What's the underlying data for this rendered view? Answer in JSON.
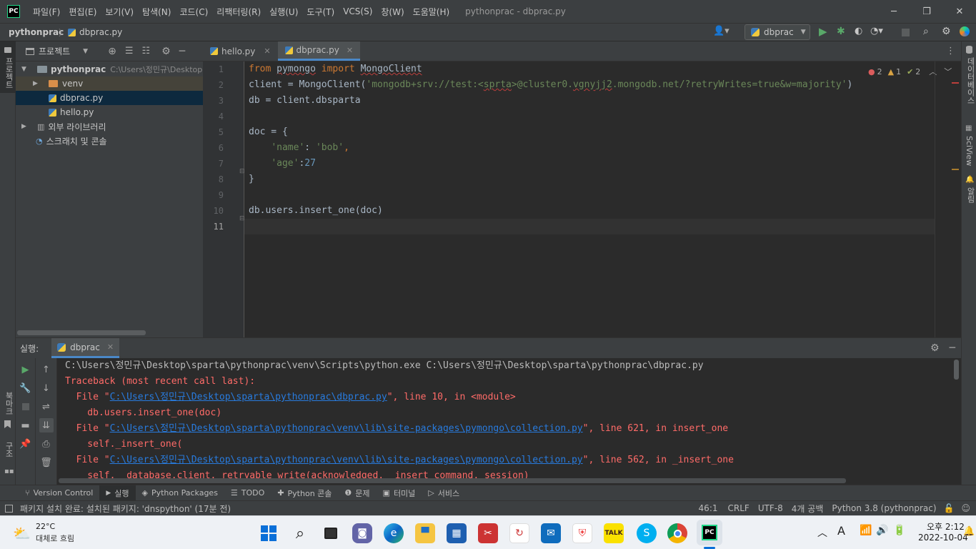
{
  "menubar": {
    "items": [
      "파일(F)",
      "편집(E)",
      "보기(V)",
      "탐색(N)",
      "코드(C)",
      "리팩터링(R)",
      "실행(U)",
      "도구(T)",
      "VCS(S)",
      "창(W)",
      "도움말(H)"
    ],
    "window_title": "pythonprac - dbprac.py"
  },
  "navbar": {
    "project": "pythonprac",
    "file": "dbprac.py",
    "run_config": "dbprac"
  },
  "leftstrip": {
    "project_label": "프로젝트",
    "structure_label": "구조",
    "bookmarks_label": "북마크"
  },
  "rightstrip": {
    "db_label": "데이터베이스",
    "sciview_label": "SciView",
    "notif_label": "알림"
  },
  "project_panel": {
    "title": "프로젝트",
    "tree": [
      {
        "label": "pythonprac",
        "hint": "C:\\Users\\정민규\\Desktop"
      },
      {
        "label": "venv"
      },
      {
        "label": "dbprac.py"
      },
      {
        "label": "hello.py"
      },
      {
        "label": "외부 라이브러리"
      },
      {
        "label": "스크래치 및 콘솔"
      }
    ]
  },
  "editor": {
    "tabs": [
      {
        "label": "hello.py"
      },
      {
        "label": "dbprac.py"
      }
    ],
    "inspections": {
      "errors": "2",
      "warnings": "1",
      "weak": "2"
    },
    "line_numbers": [
      "1",
      "2",
      "3",
      "4",
      "5",
      "6",
      "7",
      "8",
      "9",
      "10",
      "11"
    ]
  },
  "run_panel": {
    "label": "실행:",
    "tab": "dbprac",
    "console": {
      "l1": "C:\\Users\\정민규\\Desktop\\sparta\\pythonprac\\venv\\Scripts\\python.exe C:\\Users\\정민규\\Desktop\\sparta\\pythonprac\\dbprac.py",
      "l2": "Traceback (most recent call last):",
      "l3a": "  File \"",
      "l3b": "C:\\Users\\정민규\\Desktop\\sparta\\pythonprac\\dbprac.py",
      "l3c": "\", line 10, in <module>",
      "l4": "    db.users.insert_one(doc)",
      "l5a": "  File \"",
      "l5b": "C:\\Users\\정민규\\Desktop\\sparta\\pythonprac\\venv\\lib\\site-packages\\pymongo\\collection.py",
      "l5c": "\", line 621, in insert_one",
      "l6": "    self._insert_one(",
      "l7a": "  File \"",
      "l7b": "C:\\Users\\정민규\\Desktop\\sparta\\pythonprac\\venv\\lib\\site-packages\\pymongo\\collection.py",
      "l7c": "\", line 562, in _insert_one",
      "l8": "    self.__database.client._retryable_write(acknowledged, _insert_command, session)"
    }
  },
  "bottom_tools": [
    "Version Control",
    "실행",
    "Python Packages",
    "TODO",
    "Python 콘솔",
    "문제",
    "터미널",
    "서비스"
  ],
  "statusbar": {
    "message": "패키지 설치 완료: 설치된 패키지: 'dnspython' (17분 전)",
    "position": "46:1",
    "line_sep": "CRLF",
    "encoding": "UTF-8",
    "indent": "4개 공백",
    "interpreter": "Python 3.8 (pythonprac)"
  },
  "taskbar": {
    "weather_temp": "22°C",
    "weather_desc": "대체로 흐림",
    "time": "오후 2:12",
    "date": "2022-10-04",
    "kakao": "TALK"
  },
  "colors": {
    "accent": "#4a88c7",
    "error": "#ff6b68",
    "link": "#287bde",
    "keyword": "#cc7832",
    "string": "#6a8759",
    "number": "#6897bb"
  }
}
